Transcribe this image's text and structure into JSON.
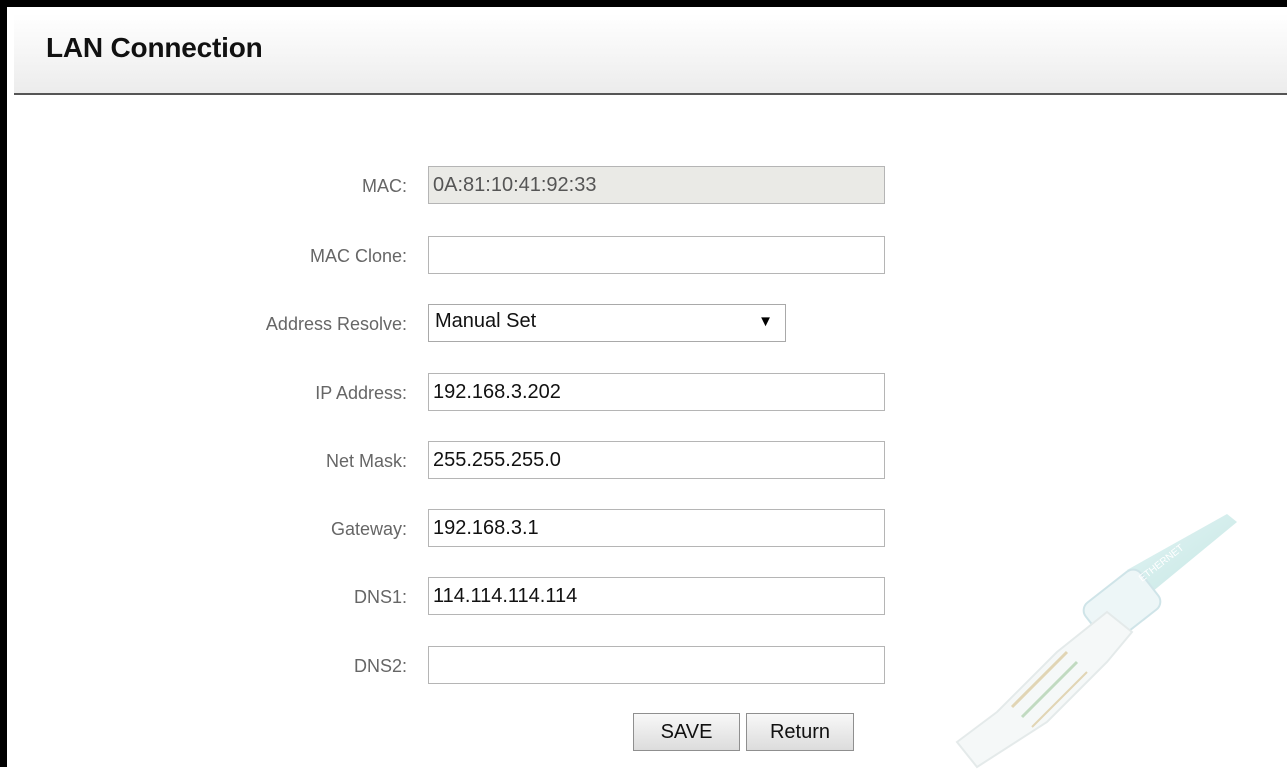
{
  "page": {
    "title": "LAN Connection"
  },
  "form": {
    "mac": {
      "label": "MAC:",
      "value": "0A:81:10:41:92:33"
    },
    "mac_clone": {
      "label": "MAC Clone:",
      "value": ""
    },
    "address_resolve": {
      "label": "Address Resolve:",
      "value": "Manual Set"
    },
    "ip_address": {
      "label": "IP Address:",
      "value": "192.168.3.202"
    },
    "net_mask": {
      "label": "Net Mask:",
      "value": "255.255.255.0"
    },
    "gateway": {
      "label": "Gateway:",
      "value": "192.168.3.1"
    },
    "dns1": {
      "label": "DNS1:",
      "value": "114.114.114.114"
    },
    "dns2": {
      "label": "DNS2:",
      "value": ""
    }
  },
  "buttons": {
    "save": "SAVE",
    "return": "Return"
  },
  "decoration": {
    "icon": "ethernet-cable-icon",
    "text": "ETHERNET"
  }
}
